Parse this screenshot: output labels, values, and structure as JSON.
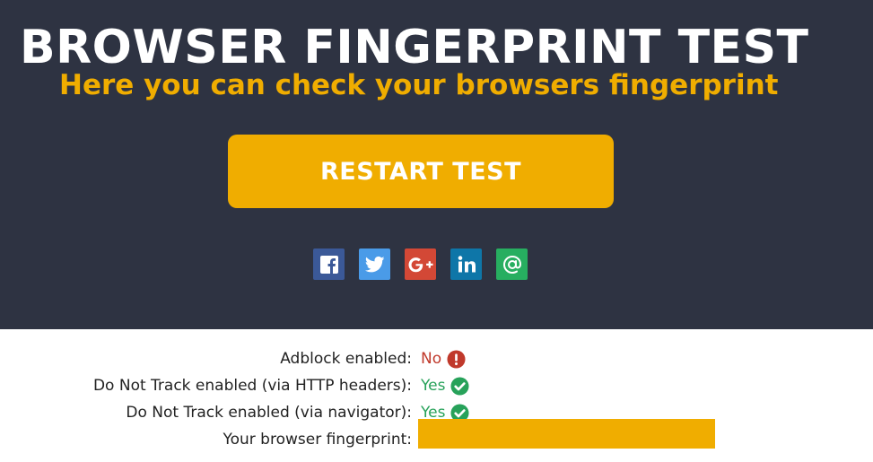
{
  "header": {
    "title": "BROWSER FINGERPRINT TEST",
    "subtitle": "Here you can check your browsers fingerprint",
    "restart_label": "RESTART TEST"
  },
  "share": [
    {
      "name": "facebook",
      "icon": "facebook-icon",
      "color": "#3b5998"
    },
    {
      "name": "twitter",
      "icon": "twitter-icon",
      "color": "#4a9be8"
    },
    {
      "name": "google-plus",
      "icon": "google-plus-icon",
      "color": "#d34836"
    },
    {
      "name": "linkedin",
      "icon": "linkedin-icon",
      "color": "#0e76a8"
    },
    {
      "name": "email",
      "icon": "at-sign-icon",
      "color": "#27ae60"
    }
  ],
  "results": {
    "adblock": {
      "label": "Adblock enabled:",
      "value": "No",
      "status": "negative"
    },
    "dnt_http": {
      "label": "Do Not Track enabled (via HTTP headers):",
      "value": "Yes",
      "status": "positive"
    },
    "dnt_navigator": {
      "label": "Do Not Track enabled (via navigator):",
      "value": "Yes",
      "status": "positive"
    },
    "fingerprint": {
      "label": "Your browser fingerprint:",
      "value": ""
    }
  },
  "colors": {
    "background_dark": "#2e3342",
    "accent": "#f0ad00",
    "negative": "#c0392b",
    "positive": "#27a25a"
  }
}
